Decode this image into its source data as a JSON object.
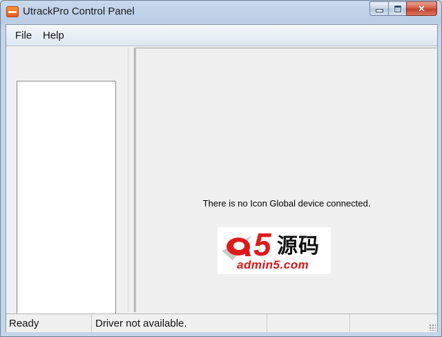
{
  "window": {
    "title": "UtrackPro Control Panel"
  },
  "menu": {
    "items": [
      {
        "label": "File"
      },
      {
        "label": "Help"
      }
    ]
  },
  "main": {
    "message": "There is no Icon Global device connected."
  },
  "watermark": {
    "number": "5",
    "chinese_text": "源码",
    "domain": "admin5.com"
  },
  "status": {
    "ready": "Ready",
    "driver": "Driver not available."
  },
  "colors": {
    "title_bar": "#c9d9ec",
    "close_button": "#c4402a",
    "logo_red": "#e01919",
    "panel_bg": "#f0f0f0"
  },
  "icons": {
    "app": "app-icon",
    "minimize": "minimize-icon",
    "maximize": "maximize-icon",
    "close": "close-icon"
  }
}
